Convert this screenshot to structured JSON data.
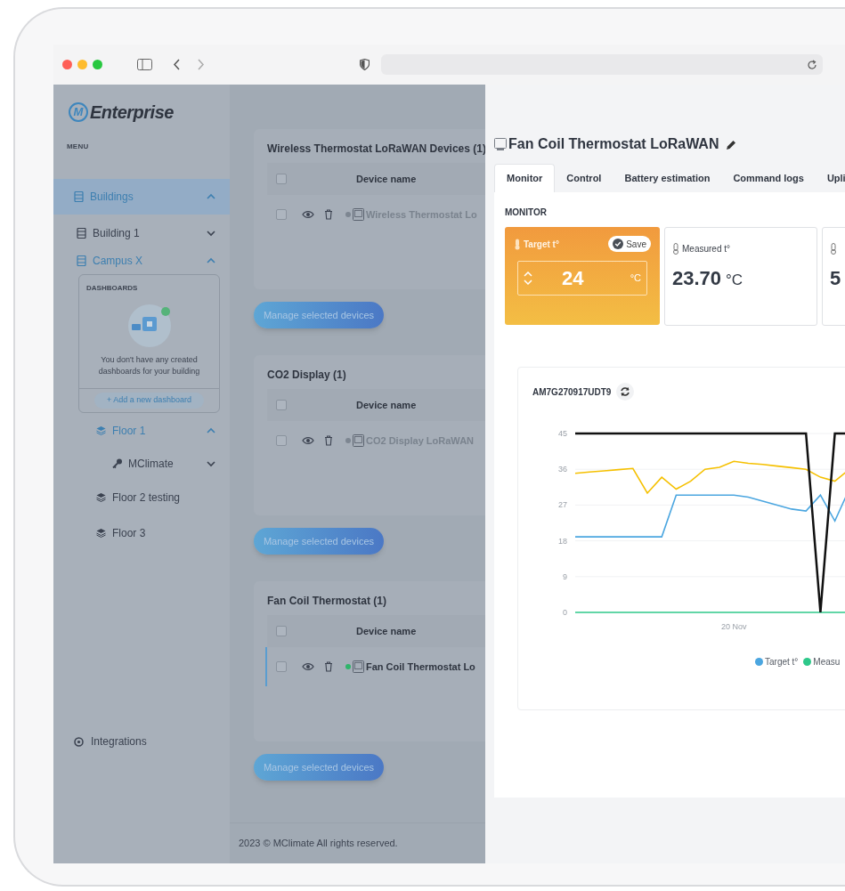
{
  "sidebar": {
    "logo": "Enterprise",
    "logo_mark": "M",
    "menu_label": "MENU",
    "items": [
      {
        "label": "Buildings",
        "selected": true,
        "active": true,
        "expanded": true,
        "children": [
          {
            "label": "Building 1",
            "selected": false,
            "active": false,
            "expanded": false
          },
          {
            "label": "Campus X",
            "selected": false,
            "active": true,
            "expanded": true,
            "dashboards": {
              "title": "DASHBOARDS",
              "message": "You don't have any created dashboards for your building",
              "add_button": "+ Add a new dashboard"
            },
            "children": [
              {
                "label": "Floor 1",
                "selected": false,
                "active": true,
                "expanded": true,
                "children": [
                  {
                    "label": "MClimate",
                    "selected": false,
                    "active": false,
                    "expanded": false
                  }
                ]
              },
              {
                "label": "Floor 2 testing",
                "selected": false,
                "active": false
              },
              {
                "label": "Floor 3",
                "selected": false,
                "active": false
              }
            ]
          }
        ]
      }
    ],
    "bottom_item": "Integrations"
  },
  "sections": [
    {
      "title": "Wireless Thermostat LoRaWAN Devices (1)",
      "column": "Device name",
      "all_checked": false,
      "rows": [
        {
          "name": "Wireless Thermostat Lo",
          "online": false,
          "highlighted": false,
          "checked": false
        }
      ],
      "button": "Manage selected devices"
    },
    {
      "title": "CO2 Display (1)",
      "column": "Device name",
      "all_checked": false,
      "rows": [
        {
          "name": "CO2 Display LoRaWAN",
          "online": false,
          "highlighted": false,
          "checked": false
        }
      ],
      "button": "Manage selected devices"
    },
    {
      "title": "Fan Coil Thermostat (1)",
      "column": "Device name",
      "all_checked": false,
      "rows": [
        {
          "name": "Fan Coil Thermostat Lo",
          "online": true,
          "highlighted": true,
          "checked": false
        }
      ],
      "button": "Manage selected devices"
    }
  ],
  "footer": "2023 © MClimate All rights reserved.",
  "drawer": {
    "title": "Fan Coil Thermostat LoRaWAN",
    "tabs": [
      {
        "label": "Monitor",
        "selected": true
      },
      {
        "label": "Control",
        "selected": false
      },
      {
        "label": "Battery estimation",
        "selected": false
      },
      {
        "label": "Command logs",
        "selected": false
      },
      {
        "label": "Upli",
        "selected": false
      }
    ],
    "section": "MONITOR",
    "cards": [
      {
        "kind": "setpoint",
        "label": "Target t°",
        "save": "Save",
        "value": "24",
        "unit": "°C"
      },
      {
        "kind": "reading",
        "label": "Measured t°",
        "value": "23.70",
        "unit": "°C"
      },
      {
        "kind": "reading",
        "value": "5"
      }
    ],
    "chart": {
      "device_id": "AM7G270917UDT9",
      "chart_data": {
        "type": "line",
        "categories": [
          null,
          null,
          null,
          null,
          null,
          null,
          null,
          null,
          null,
          null,
          null,
          "20 Nov",
          null,
          null,
          null,
          null,
          null,
          null,
          null,
          null
        ],
        "ylim": [
          0,
          45
        ],
        "grid": true,
        "yticks": [
          0,
          9,
          18,
          27,
          36,
          45
        ],
        "series": [
          {
            "name": "Target t°",
            "color": "#4ba6e0",
            "values": [
              19,
              19,
              19,
              19,
              19,
              19,
              19,
              29.5,
              29.5,
              29.5,
              29.5,
              29.5,
              29,
              28,
              27,
              26,
              25.5,
              29.5,
              23,
              31
            ]
          },
          {
            "name": "Measu",
            "color": "#2ec88a",
            "values": [
              0,
              0,
              0,
              0,
              0,
              0,
              0,
              0,
              0,
              0,
              0,
              0,
              0,
              0,
              0,
              0,
              0,
              0,
              0,
              0
            ]
          },
          {
            "color": "#f5c000",
            "values": [
              35,
              35.3,
              35.6,
              35.9,
              36.2,
              30,
              34,
              31,
              33,
              36,
              36.5,
              38,
              37.5,
              37.2,
              36.8,
              36.4,
              36,
              34,
              33,
              36
            ]
          },
          {
            "color": "#111111",
            "values": [
              45,
              45,
              45,
              45,
              45,
              45,
              45,
              45,
              45,
              45,
              45,
              45,
              45,
              45,
              45,
              45,
              45,
              0,
              45,
              45
            ]
          }
        ]
      }
    }
  }
}
